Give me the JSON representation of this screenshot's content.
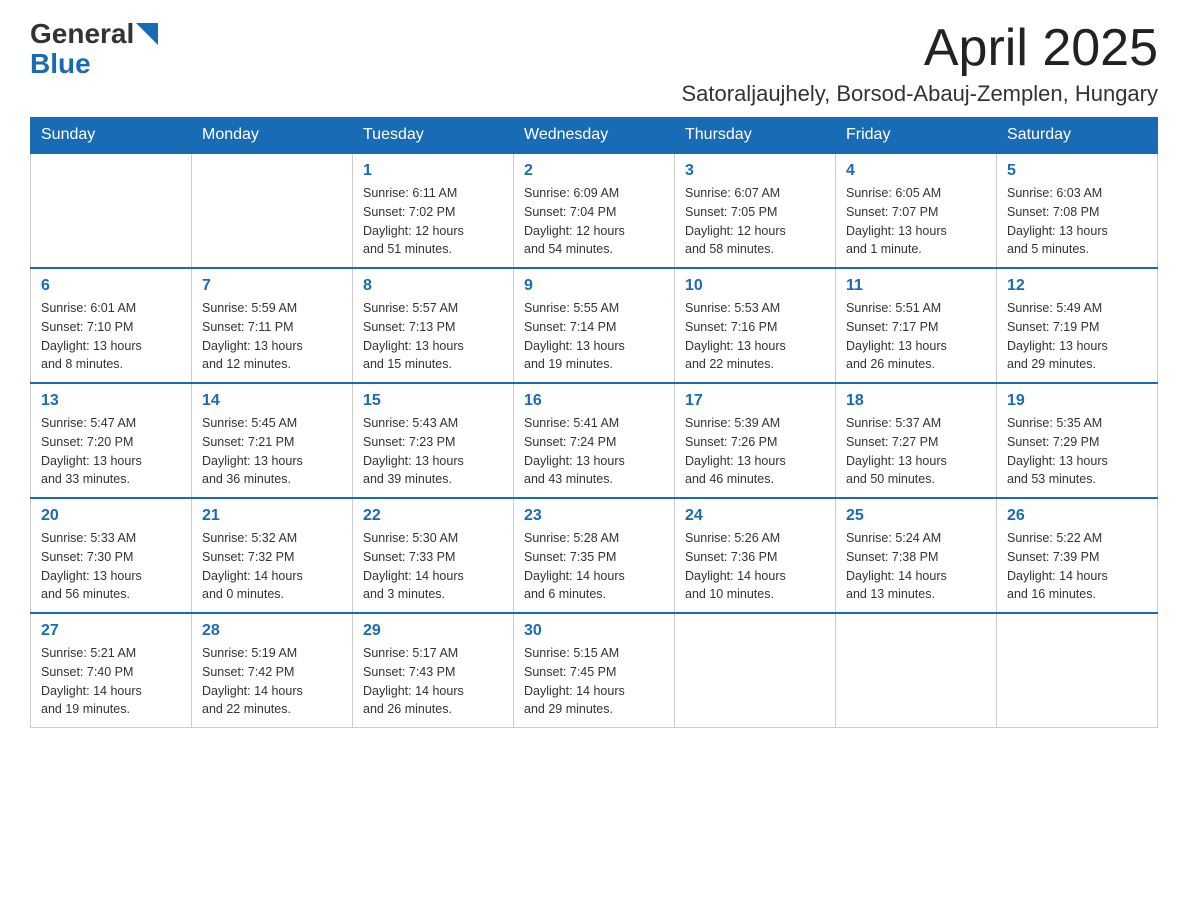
{
  "header": {
    "logo_line1": "General",
    "logo_line2": "Blue",
    "month_title": "April 2025",
    "location": "Satoraljaujhely, Borsod-Abauj-Zemplen, Hungary"
  },
  "weekdays": [
    "Sunday",
    "Monday",
    "Tuesday",
    "Wednesday",
    "Thursday",
    "Friday",
    "Saturday"
  ],
  "weeks": [
    [
      {
        "day": "",
        "info": ""
      },
      {
        "day": "",
        "info": ""
      },
      {
        "day": "1",
        "info": "Sunrise: 6:11 AM\nSunset: 7:02 PM\nDaylight: 12 hours\nand 51 minutes."
      },
      {
        "day": "2",
        "info": "Sunrise: 6:09 AM\nSunset: 7:04 PM\nDaylight: 12 hours\nand 54 minutes."
      },
      {
        "day": "3",
        "info": "Sunrise: 6:07 AM\nSunset: 7:05 PM\nDaylight: 12 hours\nand 58 minutes."
      },
      {
        "day": "4",
        "info": "Sunrise: 6:05 AM\nSunset: 7:07 PM\nDaylight: 13 hours\nand 1 minute."
      },
      {
        "day": "5",
        "info": "Sunrise: 6:03 AM\nSunset: 7:08 PM\nDaylight: 13 hours\nand 5 minutes."
      }
    ],
    [
      {
        "day": "6",
        "info": "Sunrise: 6:01 AM\nSunset: 7:10 PM\nDaylight: 13 hours\nand 8 minutes."
      },
      {
        "day": "7",
        "info": "Sunrise: 5:59 AM\nSunset: 7:11 PM\nDaylight: 13 hours\nand 12 minutes."
      },
      {
        "day": "8",
        "info": "Sunrise: 5:57 AM\nSunset: 7:13 PM\nDaylight: 13 hours\nand 15 minutes."
      },
      {
        "day": "9",
        "info": "Sunrise: 5:55 AM\nSunset: 7:14 PM\nDaylight: 13 hours\nand 19 minutes."
      },
      {
        "day": "10",
        "info": "Sunrise: 5:53 AM\nSunset: 7:16 PM\nDaylight: 13 hours\nand 22 minutes."
      },
      {
        "day": "11",
        "info": "Sunrise: 5:51 AM\nSunset: 7:17 PM\nDaylight: 13 hours\nand 26 minutes."
      },
      {
        "day": "12",
        "info": "Sunrise: 5:49 AM\nSunset: 7:19 PM\nDaylight: 13 hours\nand 29 minutes."
      }
    ],
    [
      {
        "day": "13",
        "info": "Sunrise: 5:47 AM\nSunset: 7:20 PM\nDaylight: 13 hours\nand 33 minutes."
      },
      {
        "day": "14",
        "info": "Sunrise: 5:45 AM\nSunset: 7:21 PM\nDaylight: 13 hours\nand 36 minutes."
      },
      {
        "day": "15",
        "info": "Sunrise: 5:43 AM\nSunset: 7:23 PM\nDaylight: 13 hours\nand 39 minutes."
      },
      {
        "day": "16",
        "info": "Sunrise: 5:41 AM\nSunset: 7:24 PM\nDaylight: 13 hours\nand 43 minutes."
      },
      {
        "day": "17",
        "info": "Sunrise: 5:39 AM\nSunset: 7:26 PM\nDaylight: 13 hours\nand 46 minutes."
      },
      {
        "day": "18",
        "info": "Sunrise: 5:37 AM\nSunset: 7:27 PM\nDaylight: 13 hours\nand 50 minutes."
      },
      {
        "day": "19",
        "info": "Sunrise: 5:35 AM\nSunset: 7:29 PM\nDaylight: 13 hours\nand 53 minutes."
      }
    ],
    [
      {
        "day": "20",
        "info": "Sunrise: 5:33 AM\nSunset: 7:30 PM\nDaylight: 13 hours\nand 56 minutes."
      },
      {
        "day": "21",
        "info": "Sunrise: 5:32 AM\nSunset: 7:32 PM\nDaylight: 14 hours\nand 0 minutes."
      },
      {
        "day": "22",
        "info": "Sunrise: 5:30 AM\nSunset: 7:33 PM\nDaylight: 14 hours\nand 3 minutes."
      },
      {
        "day": "23",
        "info": "Sunrise: 5:28 AM\nSunset: 7:35 PM\nDaylight: 14 hours\nand 6 minutes."
      },
      {
        "day": "24",
        "info": "Sunrise: 5:26 AM\nSunset: 7:36 PM\nDaylight: 14 hours\nand 10 minutes."
      },
      {
        "day": "25",
        "info": "Sunrise: 5:24 AM\nSunset: 7:38 PM\nDaylight: 14 hours\nand 13 minutes."
      },
      {
        "day": "26",
        "info": "Sunrise: 5:22 AM\nSunset: 7:39 PM\nDaylight: 14 hours\nand 16 minutes."
      }
    ],
    [
      {
        "day": "27",
        "info": "Sunrise: 5:21 AM\nSunset: 7:40 PM\nDaylight: 14 hours\nand 19 minutes."
      },
      {
        "day": "28",
        "info": "Sunrise: 5:19 AM\nSunset: 7:42 PM\nDaylight: 14 hours\nand 22 minutes."
      },
      {
        "day": "29",
        "info": "Sunrise: 5:17 AM\nSunset: 7:43 PM\nDaylight: 14 hours\nand 26 minutes."
      },
      {
        "day": "30",
        "info": "Sunrise: 5:15 AM\nSunset: 7:45 PM\nDaylight: 14 hours\nand 29 minutes."
      },
      {
        "day": "",
        "info": ""
      },
      {
        "day": "",
        "info": ""
      },
      {
        "day": "",
        "info": ""
      }
    ]
  ]
}
